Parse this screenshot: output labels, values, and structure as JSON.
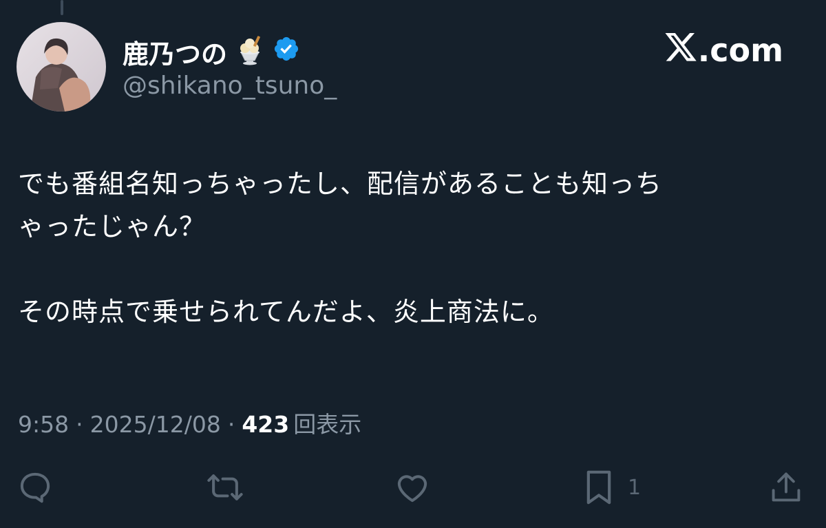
{
  "colors": {
    "background": "#15202b",
    "text_primary": "#ffffff",
    "text_secondary": "#8b98a5",
    "icon_muted": "#5b6875",
    "verified_blue": "#1d9bf0"
  },
  "author": {
    "display_name": "鹿乃つの",
    "name_emoji": "ice-cream-parfait-icon",
    "verified_badge": "verified-icon",
    "handle": "@shikano_tsuno_",
    "avatar": "avatar"
  },
  "brand": {
    "logo": "x-logo-icon",
    "suffix": ".com"
  },
  "tweet": {
    "paragraph1": "でも番組名知っちゃったし、配信があることも知っち\nゃったじゃん？",
    "paragraph2": "その時点で乗せられてんだよ、炎上商法に。"
  },
  "meta": {
    "time": "9:58",
    "separator": "·",
    "date": "2025/12/08",
    "views_count": "423",
    "views_label": "回表示"
  },
  "actions": {
    "reply_icon": "reply-icon",
    "retweet_icon": "retweet-icon",
    "like_icon": "like-icon",
    "bookmark_icon": "bookmark-icon",
    "bookmark_count": "1",
    "share_icon": "share-icon"
  }
}
